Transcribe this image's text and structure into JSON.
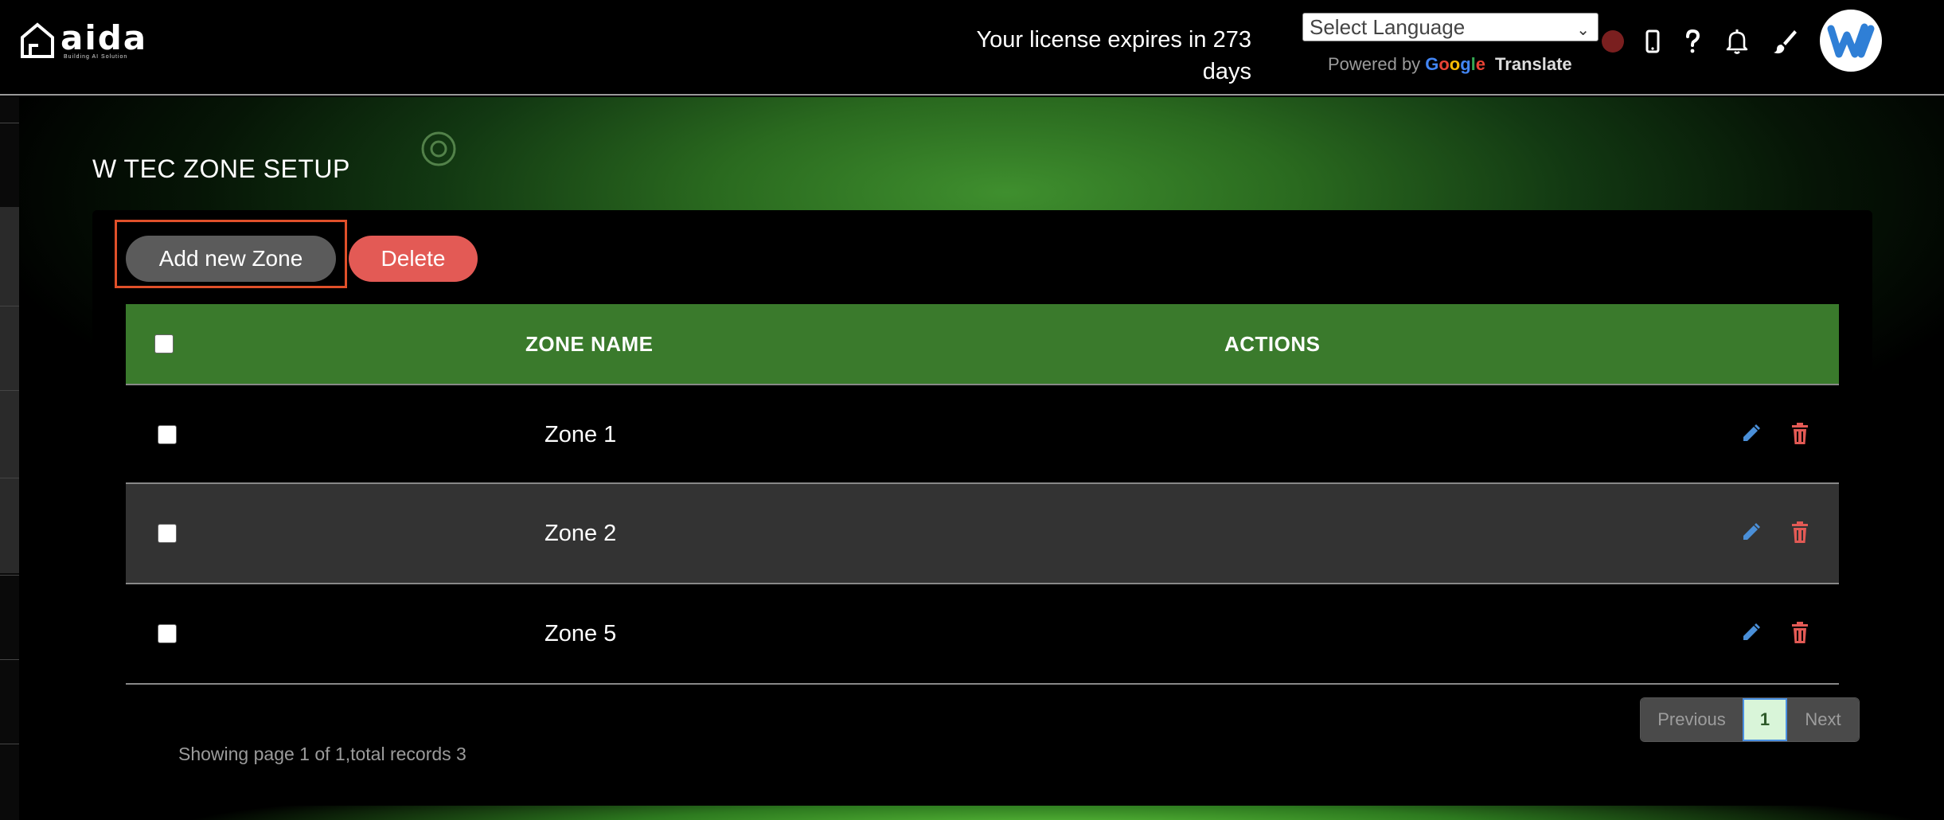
{
  "header": {
    "logo_text": "aida",
    "logo_tagline": "Building AI Solution",
    "license_text": "Your license expires in 273 days",
    "language_select": "Select Language",
    "powered_by": "Powered by",
    "google_letters": [
      "G",
      "o",
      "o",
      "g",
      "l",
      "e"
    ],
    "translate": "Translate",
    "status_color": "#7a1f1f",
    "icons": [
      "mobile-icon",
      "help-icon",
      "bell-icon",
      "brush-icon"
    ],
    "avatar_icon": "w-tec-logo"
  },
  "page": {
    "title": "W TEC ZONE SETUP",
    "add_button": "Add new Zone",
    "delete_button": "Delete"
  },
  "table": {
    "headers": {
      "name": "ZONE NAME",
      "actions": "ACTIONS"
    },
    "header_color": "#3a7a2c",
    "rows": [
      {
        "name": "Zone 1"
      },
      {
        "name": "Zone 2"
      },
      {
        "name": "Zone 5"
      }
    ]
  },
  "pagination": {
    "previous": "Previous",
    "current": "1",
    "next": "Next",
    "summary": "Showing page 1 of 1,total records 3"
  }
}
